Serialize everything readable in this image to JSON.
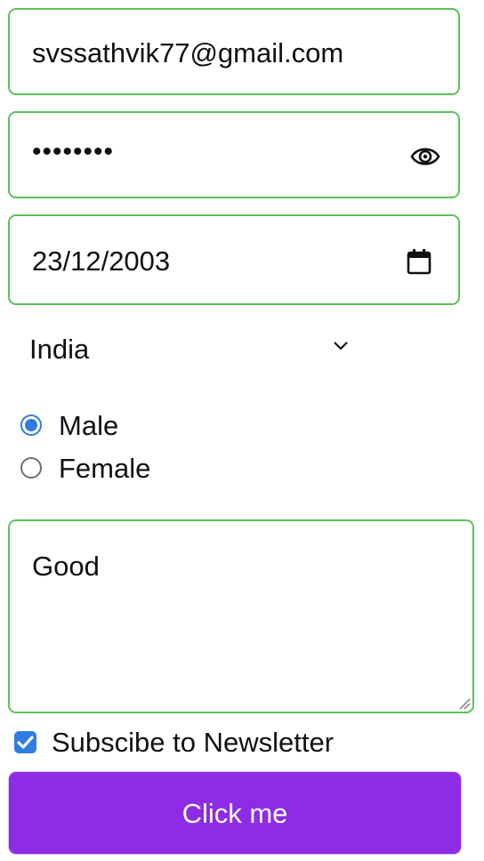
{
  "form": {
    "email_value": "svssathvik77@gmail.com",
    "password_mask": "••••••••",
    "date_value": "23/12/2003",
    "country_selected": "India",
    "gender_options": [
      {
        "label": "Male",
        "checked": true
      },
      {
        "label": "Female",
        "checked": false
      }
    ],
    "comment_value": "Good",
    "newsletter_label": "Subscibe to Newsletter",
    "newsletter_checked": true,
    "submit_label": "Click me"
  },
  "colors": {
    "field_border": "#5cc15c",
    "accent_blue": "#2f7de3",
    "button_purple": "#8e2be6"
  },
  "icons": {
    "password_toggle": "eye-icon",
    "date_picker": "calendar-icon",
    "select_arrow": "chevron-down-icon",
    "checkbox_mark": "checkmark-icon"
  }
}
